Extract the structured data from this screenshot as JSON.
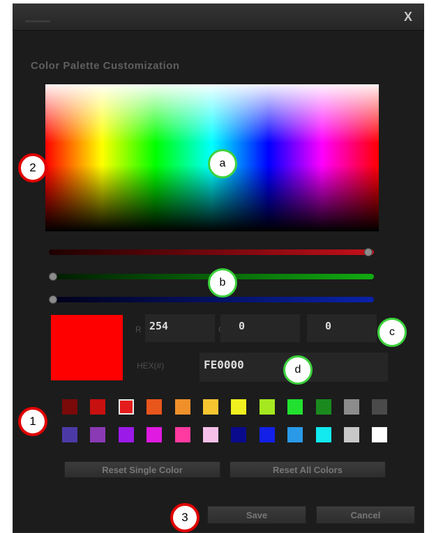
{
  "dialog": {
    "close_glyph": "X",
    "heading": "Color Palette Customization"
  },
  "color": {
    "r_label": "R",
    "r_value": "254",
    "g_label": "G",
    "g_value": "0",
    "b_label": "B",
    "b_value": "0",
    "hex_label": "HEX(#)",
    "hex_value": "FE0000",
    "preview_color": "#fe0000",
    "slider_levels": {
      "r": 0.996,
      "g": 0.0,
      "b": 0.0
    }
  },
  "palette": {
    "selected_index": 2,
    "row1": [
      "#7a0a0a",
      "#c81010",
      "#e51c1c",
      "#e8561c",
      "#f0902a",
      "#f6c530",
      "#f0f020",
      "#a6e820",
      "#22e030",
      "#1a8a1e",
      "#8c8c8c",
      "#4a4a4a"
    ],
    "row2": [
      "#4b3aa6",
      "#8a3ab4",
      "#9b1ae8",
      "#e01ae0",
      "#ff3aa0",
      "#f6c0e8",
      "#0a0a8c",
      "#1220e8",
      "#2a9ae8",
      "#12eaf0",
      "#c8c8c8",
      "#ffffff"
    ]
  },
  "buttons": {
    "reset_single": "Reset Single Color",
    "reset_all": "Reset All Colors",
    "save": "Save",
    "cancel": "Cancel"
  },
  "callouts": {
    "red": [
      "1",
      "2",
      "3"
    ],
    "green": [
      "a",
      "b",
      "c",
      "d"
    ]
  }
}
